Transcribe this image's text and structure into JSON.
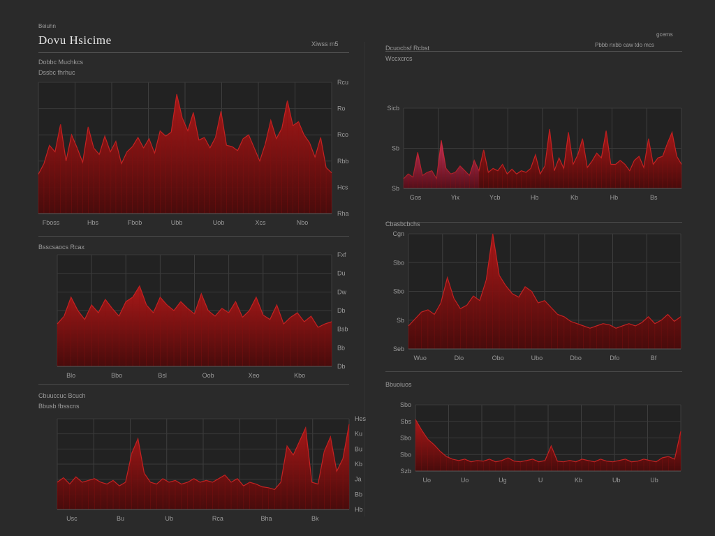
{
  "dashboard": {
    "eyebrow": "Beiuhn",
    "title": "Dovu Hsicime",
    "top_meta": "Xiwss m5",
    "right_eyebrow": "gcems",
    "right_meta": "Pbbb nxbb caw tdo mcs"
  },
  "colors": {
    "background": "#2a2a2a",
    "primary_red": "#b01818",
    "dark_red": "#4a0a0a",
    "pink_accent": "#e0407a",
    "grey_accent": "#9a9a9a"
  },
  "chart_data": [
    {
      "id": "c1",
      "type": "area",
      "title": "Dobbc Muchkcs",
      "subtitle": "Dssbc fhrhuc",
      "x_ticks": [
        "Fboss",
        "Hbs",
        "Fbob",
        "Ubb",
        "Uob",
        "Xcs",
        "Nbo"
      ],
      "y_ticks": [
        "Rcu",
        "Ro",
        "Rco",
        "Rbb",
        "Hcs",
        "Rha"
      ],
      "ylim": [
        0,
        100
      ],
      "values": [
        30,
        38,
        52,
        47,
        68,
        40,
        60,
        50,
        39,
        66,
        50,
        45,
        59,
        47,
        55,
        38,
        47,
        51,
        58,
        50,
        57,
        46,
        63,
        59,
        62,
        91,
        73,
        63,
        77,
        56,
        58,
        50,
        58,
        78,
        52,
        51,
        48,
        57,
        60,
        50,
        40,
        53,
        71,
        57,
        65,
        86,
        67,
        70,
        60,
        54,
        43,
        58,
        35,
        31
      ]
    },
    {
      "id": "c2",
      "type": "area",
      "title": "Dcuocbsf Rcbst",
      "subtitle": "Wccxcrcs",
      "x_ticks": [
        "Gos",
        "Yix",
        "Ycb",
        "Hb",
        "Kb",
        "Hb",
        "Bs"
      ],
      "y_ticks": [
        "Sicb",
        "Sb",
        "Sb"
      ],
      "ylim": [
        0,
        100
      ],
      "values": [
        12,
        18,
        14,
        45,
        16,
        20,
        22,
        12,
        60,
        25,
        18,
        20,
        28,
        22,
        16,
        35,
        22,
        48,
        20,
        25,
        22,
        30,
        18,
        24,
        18,
        22,
        20,
        25,
        42,
        18,
        28,
        74,
        22,
        38,
        25,
        70,
        30,
        42,
        62,
        26,
        34,
        44,
        38,
        72,
        30,
        30,
        35,
        30,
        22,
        35,
        40,
        26,
        62,
        30,
        38,
        40,
        56,
        70,
        40,
        30
      ]
    },
    {
      "id": "c3",
      "type": "area",
      "title": "Bsscsaocs Rcax",
      "subtitle": "",
      "x_ticks": [
        "Blo",
        "Bbo",
        "Bsl",
        "Oob",
        "Xeo",
        "Kbo"
      ],
      "y_ticks": [
        "Fxf",
        "Du",
        "Dw",
        "Db",
        "Bsb",
        "Bb",
        "Db"
      ],
      "ylim": [
        0,
        100
      ],
      "values": [
        38,
        45,
        62,
        50,
        42,
        55,
        48,
        60,
        52,
        45,
        58,
        62,
        72,
        55,
        48,
        62,
        55,
        50,
        58,
        52,
        47,
        65,
        50,
        45,
        52,
        48,
        58,
        44,
        50,
        62,
        46,
        42,
        55,
        38,
        44,
        48,
        40,
        45,
        35,
        38,
        40
      ]
    },
    {
      "id": "c4",
      "type": "area",
      "title": "Cbasbcbchs",
      "subtitle": "",
      "x_ticks": [
        "Wuo",
        "Dlo",
        "Obo",
        "Ubo",
        "Dbo",
        "Dfo",
        "Bf"
      ],
      "y_ticks": [
        "Cgn",
        "Sbo",
        "Sbo",
        "Sb",
        "Seb"
      ],
      "ylim": [
        0,
        100
      ],
      "values": [
        20,
        26,
        32,
        34,
        30,
        40,
        62,
        44,
        35,
        38,
        46,
        42,
        60,
        100,
        64,
        55,
        48,
        45,
        54,
        50,
        40,
        42,
        36,
        30,
        28,
        24,
        22,
        20,
        18,
        20,
        22,
        21,
        18,
        20,
        22,
        20,
        23,
        28,
        22,
        25,
        30,
        24,
        28
      ]
    },
    {
      "id": "c5",
      "type": "area",
      "title": "Cbuuccuc Bcuch",
      "subtitle": "Bbusb fbsscns",
      "x_ticks": [
        "Usc",
        "Bu",
        "Ub",
        "Rca",
        "Bha",
        "Bk"
      ],
      "y_ticks": [
        "Hes",
        "Ku",
        "Bu",
        "Kb",
        "Ja",
        "Bb",
        "Hb"
      ],
      "ylim": [
        0,
        100
      ],
      "values": [
        30,
        35,
        28,
        36,
        30,
        32,
        34,
        30,
        28,
        32,
        26,
        30,
        62,
        78,
        40,
        30,
        28,
        34,
        30,
        32,
        28,
        30,
        34,
        30,
        32,
        30,
        34,
        38,
        30,
        34,
        26,
        30,
        28,
        25,
        24,
        22,
        30,
        70,
        60,
        75,
        90,
        30,
        28,
        64,
        80,
        42,
        56,
        94
      ]
    },
    {
      "id": "c6",
      "type": "area",
      "title": "Bbuoiuos",
      "subtitle": "",
      "x_ticks": [
        "Uo",
        "Uo",
        "Ug",
        "U",
        "Kb",
        "Ub",
        "Ub"
      ],
      "y_ticks": [
        "Sbo",
        "Sbs",
        "Sbo",
        "Sbo",
        "Szb"
      ],
      "ylim": [
        0,
        100
      ],
      "values": [
        78,
        62,
        48,
        40,
        30,
        22,
        18,
        16,
        18,
        14,
        16,
        15,
        18,
        14,
        16,
        20,
        15,
        14,
        16,
        18,
        14,
        16,
        38,
        15,
        14,
        16,
        14,
        18,
        16,
        14,
        18,
        15,
        14,
        16,
        18,
        14,
        15,
        18,
        16,
        14,
        20,
        22,
        18,
        60
      ]
    }
  ]
}
